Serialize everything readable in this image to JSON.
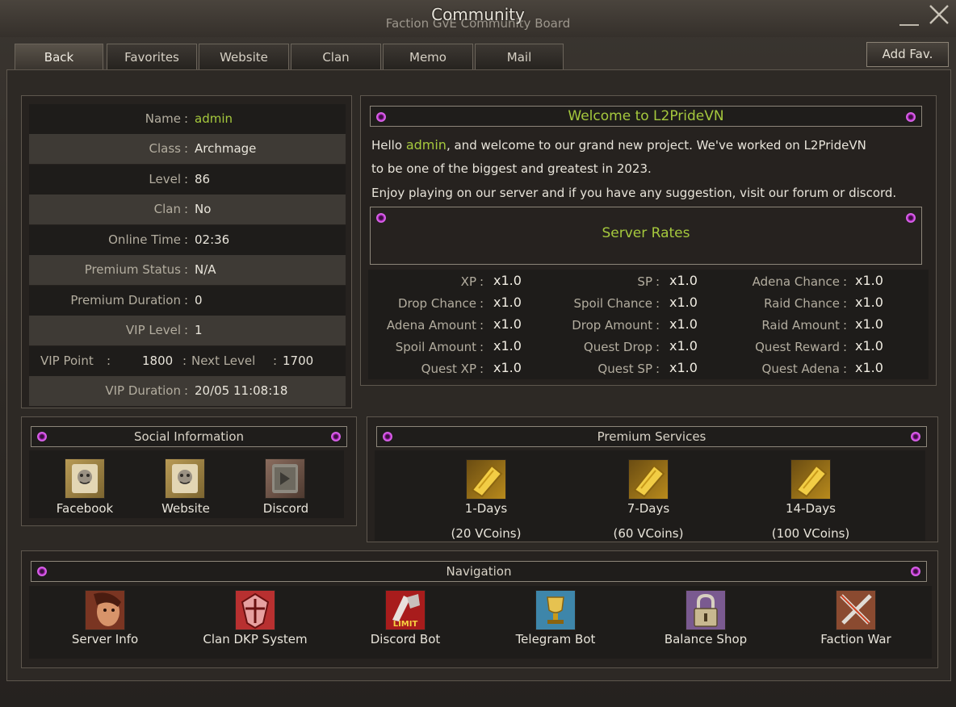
{
  "window": {
    "title": "Community",
    "subtitle": "Faction GvE Community Board"
  },
  "tabs": [
    {
      "label": "Back",
      "active": true
    },
    {
      "label": "Favorites"
    },
    {
      "label": "Website"
    },
    {
      "label": "Clan"
    },
    {
      "label": "Memo"
    },
    {
      "label": "Mail"
    }
  ],
  "add_fav_label": "Add Fav.",
  "character": {
    "rows": [
      {
        "label": "Name",
        "value": "admin"
      },
      {
        "label": "Class",
        "value": "Archmage"
      },
      {
        "label": "Level",
        "value": "86"
      },
      {
        "label": "Clan",
        "value": "No"
      },
      {
        "label": "Online Time",
        "value": "02:36"
      },
      {
        "label": "Premium Status",
        "value": "N/A"
      },
      {
        "label": "Premium Duration",
        "value": "0"
      },
      {
        "label": "VIP Level",
        "value": "1"
      }
    ],
    "vip_point_label": "VIP Point",
    "vip_point_value": "1800",
    "next_level_label": "Next Level",
    "next_level_value": "1700",
    "vip_duration_label": "VIP Duration",
    "vip_duration_value": "20/05 11:08:18",
    "separator": ":"
  },
  "welcome": {
    "title": "Welcome to L2PrideVN",
    "hello": "Hello",
    "username": "admin",
    "line1_rest": ", and welcome to our grand new project. We've worked on L2PrideVN",
    "line2": "to be one of the biggest and greatest in 2023.",
    "line3": "Enjoy playing on our server and if you have any suggestion, visit our forum or discord."
  },
  "server_rates": {
    "title": "Server Rates",
    "rates": [
      {
        "label": "XP",
        "value": "x1.0"
      },
      {
        "label": "SP",
        "value": "x1.0"
      },
      {
        "label": "Adena Chance",
        "value": "x1.0"
      },
      {
        "label": "Drop Chance",
        "value": "x1.0"
      },
      {
        "label": "Spoil Chance",
        "value": "x1.0"
      },
      {
        "label": "Raid Chance",
        "value": "x1.0"
      },
      {
        "label": "Adena Amount",
        "value": "x1.0"
      },
      {
        "label": "Drop Amount",
        "value": "x1.0"
      },
      {
        "label": "Raid Amount",
        "value": "x1.0"
      },
      {
        "label": "Spoil Amount",
        "value": "x1.0"
      },
      {
        "label": "Quest Drop",
        "value": "x1.0"
      },
      {
        "label": "Quest Reward",
        "value": "x1.0"
      },
      {
        "label": "Quest XP",
        "value": "x1.0"
      },
      {
        "label": "Quest SP",
        "value": "x1.0"
      },
      {
        "label": "Quest Adena",
        "value": "x1.0"
      }
    ]
  },
  "social": {
    "title": "Social Information",
    "items": [
      {
        "label": "Facebook",
        "icon": "tiger-scroll-icon"
      },
      {
        "label": "Website",
        "icon": "tiger-scroll-icon"
      },
      {
        "label": "Discord",
        "icon": "scroll-icon"
      }
    ]
  },
  "premium": {
    "title": "Premium Services",
    "items": [
      {
        "label": "1-Days",
        "price": "(20 VCoins)",
        "icon": "golden-ticket-icon"
      },
      {
        "label": "7-Days",
        "price": "(60 VCoins)",
        "icon": "golden-ticket-icon"
      },
      {
        "label": "14-Days",
        "price": "(100 VCoins)",
        "icon": "golden-ticket-icon"
      }
    ]
  },
  "navigation": {
    "title": "Navigation",
    "items": [
      {
        "label": "Server Info",
        "icon": "portrait-icon"
      },
      {
        "label": "Clan DKP System",
        "icon": "clan-crest-icon"
      },
      {
        "label": "Discord Bot",
        "icon": "limit-icon",
        "icon_text": "LIMIT"
      },
      {
        "label": "Telegram Bot",
        "icon": "trophy-icon"
      },
      {
        "label": "Balance Shop",
        "icon": "padlock-icon"
      },
      {
        "label": "Faction War",
        "icon": "crossed-swords-icon"
      }
    ]
  }
}
